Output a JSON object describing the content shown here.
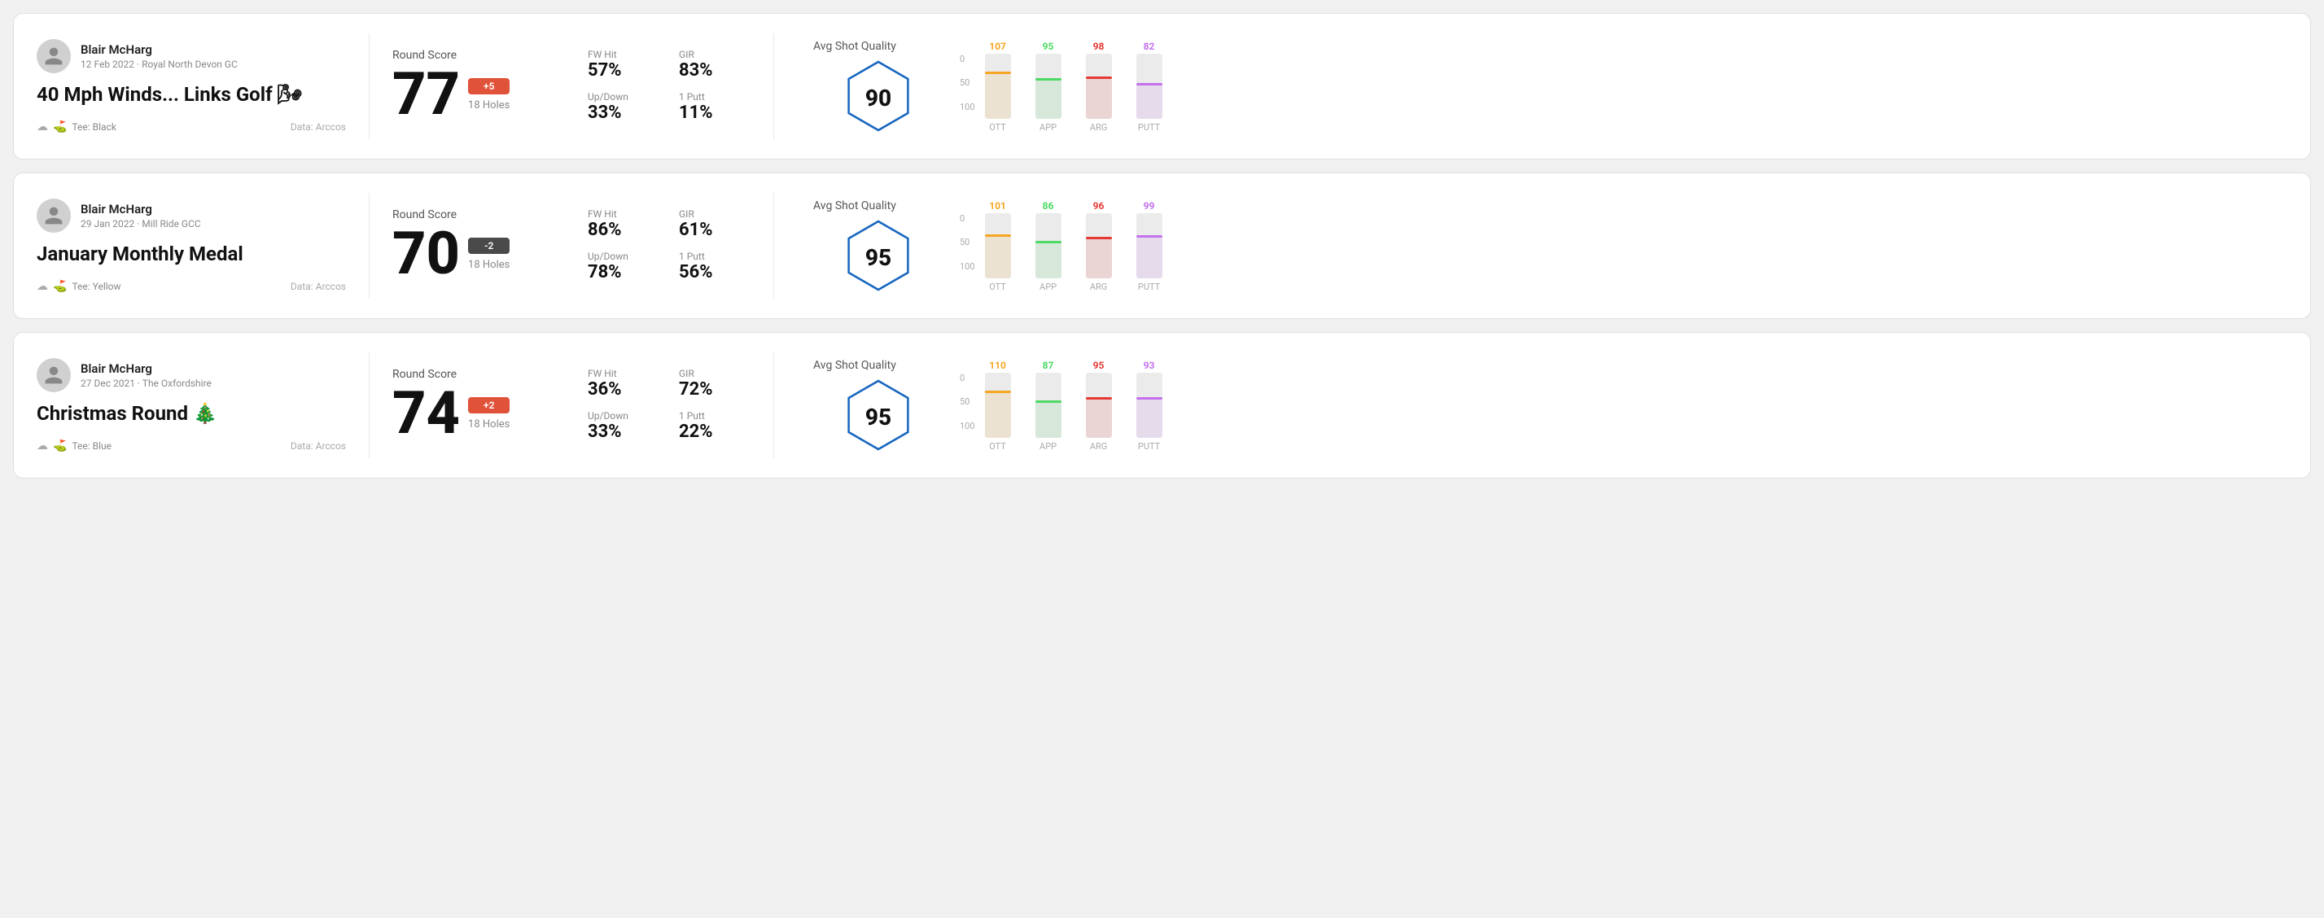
{
  "rounds": [
    {
      "id": "round1",
      "user": {
        "name": "Blair McHarg",
        "meta": "12 Feb 2022 · Royal North Devon GC"
      },
      "title": "40 Mph Winds... Links Golf 🌬",
      "tee": "Black",
      "data_source": "Data: Arccos",
      "score": {
        "value": "77",
        "badge": "+5",
        "badge_type": "positive",
        "holes": "18 Holes"
      },
      "stats": {
        "fw_hit_label": "FW Hit",
        "fw_hit_value": "57%",
        "gir_label": "GIR",
        "gir_value": "83%",
        "updown_label": "Up/Down",
        "updown_value": "33%",
        "putt_label": "1 Putt",
        "putt_value": "11%"
      },
      "quality": {
        "label": "Avg Shot Quality",
        "score": "90"
      },
      "chart": {
        "bars": [
          {
            "label": "OTT",
            "value": 107,
            "color": "#f5a623",
            "height_pct": 72
          },
          {
            "label": "APP",
            "value": 95,
            "color": "#4cd964",
            "height_pct": 63
          },
          {
            "label": "ARG",
            "value": 98,
            "color": "#e53935",
            "height_pct": 65
          },
          {
            "label": "PUTT",
            "value": 82,
            "color": "#c471ed",
            "height_pct": 55
          }
        ],
        "y_labels": [
          "100",
          "50",
          "0"
        ]
      }
    },
    {
      "id": "round2",
      "user": {
        "name": "Blair McHarg",
        "meta": "29 Jan 2022 · Mill Ride GCC"
      },
      "title": "January Monthly Medal",
      "tee": "Yellow",
      "data_source": "Data: Arccos",
      "score": {
        "value": "70",
        "badge": "-2",
        "badge_type": "negative",
        "holes": "18 Holes"
      },
      "stats": {
        "fw_hit_label": "FW Hit",
        "fw_hit_value": "86%",
        "gir_label": "GIR",
        "gir_value": "61%",
        "updown_label": "Up/Down",
        "updown_value": "78%",
        "putt_label": "1 Putt",
        "putt_value": "56%"
      },
      "quality": {
        "label": "Avg Shot Quality",
        "score": "95"
      },
      "chart": {
        "bars": [
          {
            "label": "OTT",
            "value": 101,
            "color": "#f5a623",
            "height_pct": 67
          },
          {
            "label": "APP",
            "value": 86,
            "color": "#4cd964",
            "height_pct": 57
          },
          {
            "label": "ARG",
            "value": 96,
            "color": "#e53935",
            "height_pct": 64
          },
          {
            "label": "PUTT",
            "value": 99,
            "color": "#c471ed",
            "height_pct": 66
          }
        ],
        "y_labels": [
          "100",
          "50",
          "0"
        ]
      }
    },
    {
      "id": "round3",
      "user": {
        "name": "Blair McHarg",
        "meta": "27 Dec 2021 · The Oxfordshire"
      },
      "title": "Christmas Round 🎄",
      "tee": "Blue",
      "data_source": "Data: Arccos",
      "score": {
        "value": "74",
        "badge": "+2",
        "badge_type": "positive",
        "holes": "18 Holes"
      },
      "stats": {
        "fw_hit_label": "FW Hit",
        "fw_hit_value": "36%",
        "gir_label": "GIR",
        "gir_value": "72%",
        "updown_label": "Up/Down",
        "updown_value": "33%",
        "putt_label": "1 Putt",
        "putt_value": "22%"
      },
      "quality": {
        "label": "Avg Shot Quality",
        "score": "95"
      },
      "chart": {
        "bars": [
          {
            "label": "OTT",
            "value": 110,
            "color": "#f5a623",
            "height_pct": 73
          },
          {
            "label": "APP",
            "value": 87,
            "color": "#4cd964",
            "height_pct": 58
          },
          {
            "label": "ARG",
            "value": 95,
            "color": "#e53935",
            "height_pct": 63
          },
          {
            "label": "PUTT",
            "value": 93,
            "color": "#c471ed",
            "height_pct": 62
          }
        ],
        "y_labels": [
          "100",
          "50",
          "0"
        ]
      }
    }
  ]
}
